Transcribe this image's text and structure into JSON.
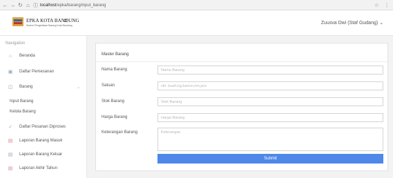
{
  "browser": {
    "back_icon": "back-arrow-icon",
    "forward_icon": "forward-arrow-icon",
    "reload_icon": "reload-icon",
    "home_icon": "home-icon",
    "url_host": "localhost",
    "url_path": "/epka/barang/input_barang"
  },
  "header": {
    "brand": "EPKA KOTA BANDUNG",
    "brand_sub": "Sistem Pengelolaan Barang Kota Bandung",
    "user": "Zuusva Dwi (Staf Gudang)"
  },
  "sidebar": {
    "title": "Navigation",
    "items": [
      {
        "label": "Beranda",
        "icon": "home-icon"
      },
      {
        "label": "Daftar Pemesanan",
        "icon": "document-icon"
      },
      {
        "label": "Barang",
        "icon": "box-icon"
      },
      {
        "label": "Input Barang"
      },
      {
        "label": "Kelola Barang"
      },
      {
        "label": "Daftar Pesanan Diproses",
        "icon": "check-icon"
      },
      {
        "label": "Laporan Barang Masuk",
        "icon": "report-icon"
      },
      {
        "label": "Laporan Barang Keluar",
        "icon": "report-icon"
      },
      {
        "label": "Laporan Akhir Tahun",
        "icon": "report-icon"
      }
    ]
  },
  "form": {
    "title": "Master Barang",
    "fields": [
      {
        "label": "Nama Barang",
        "placeholder": "Nama Barang"
      },
      {
        "label": "Satuan",
        "placeholder": "cth: buah,kg,karton,rim,pcs"
      },
      {
        "label": "Stok Barang",
        "placeholder": "Stok Barang"
      },
      {
        "label": "Harga Barang",
        "placeholder": "Harga Barang"
      },
      {
        "label": "Keterangan Barang",
        "placeholder": "Keterangan"
      }
    ],
    "submit_label": "Submit"
  },
  "colors": {
    "accent": "#4e88e8"
  }
}
